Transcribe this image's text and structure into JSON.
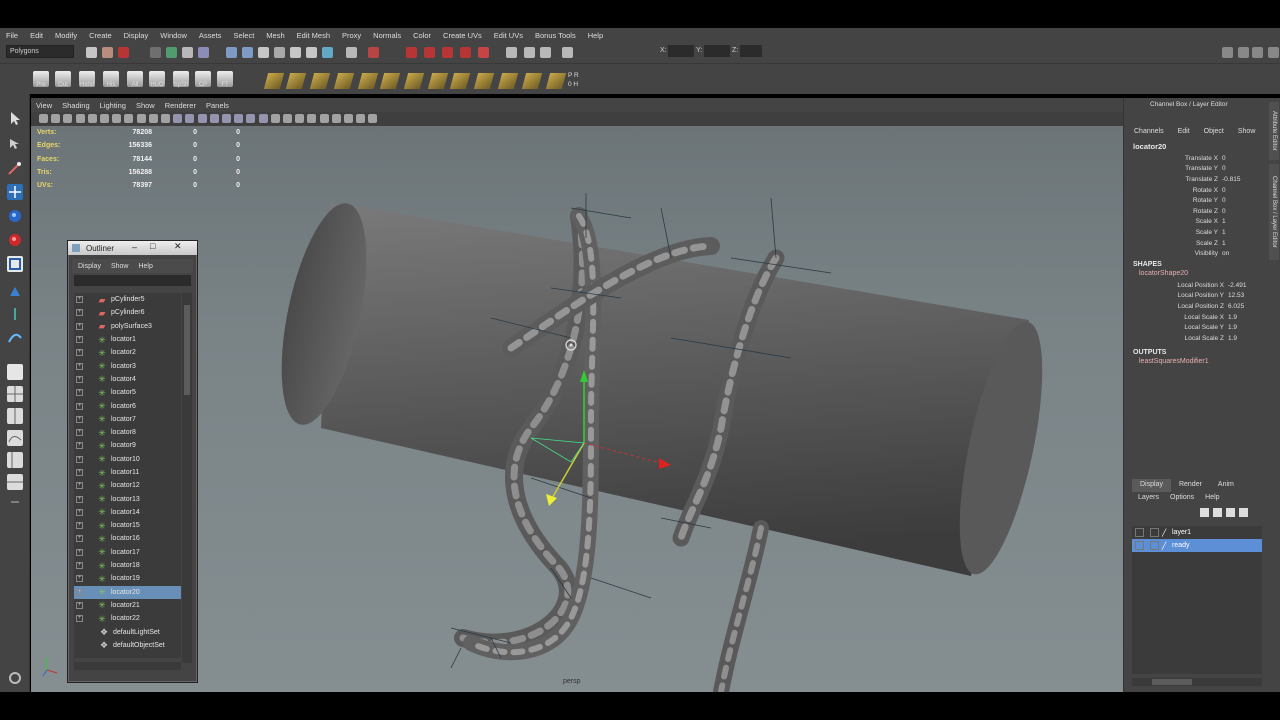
{
  "menubar": [
    "File",
    "Edit",
    "Modify",
    "Create",
    "Display",
    "Window",
    "Assets",
    "Select",
    "Mesh",
    "Edit Mesh",
    "Proxy",
    "Normals",
    "Color",
    "Create UVs",
    "Edit UVs",
    "Bonus Tools",
    "Help"
  ],
  "mode_select": "Polygons",
  "shelf_labels": [
    "Pre",
    "Out",
    "Hshd",
    "His",
    "All",
    "HUO",
    "SpSh",
    "CP",
    "FT"
  ],
  "coord_labels": [
    "X:",
    "Y:",
    "Z:"
  ],
  "pr_labels": [
    "P R",
    "0 H"
  ],
  "viewport": {
    "menu": [
      "View",
      "Shading",
      "Lighting",
      "Show",
      "Renderer",
      "Panels"
    ],
    "camera": "persp",
    "hud": [
      {
        "label": "Verts:",
        "v1": "78208",
        "v2": "0",
        "v3": "0"
      },
      {
        "label": "Edges:",
        "v1": "156336",
        "v2": "0",
        "v3": "0"
      },
      {
        "label": "Faces:",
        "v1": "78144",
        "v2": "0",
        "v3": "0"
      },
      {
        "label": "Tris:",
        "v1": "156288",
        "v2": "0",
        "v3": "0"
      },
      {
        "label": "UVs:",
        "v1": "78397",
        "v2": "0",
        "v3": "0"
      }
    ]
  },
  "outliner": {
    "title": "Outliner",
    "menu": [
      "Display",
      "Show",
      "Help"
    ],
    "items": [
      {
        "name": "pCylinder5",
        "icon": "mesh"
      },
      {
        "name": "pCylinder6",
        "icon": "mesh"
      },
      {
        "name": "polySurface3",
        "icon": "mesh"
      },
      {
        "name": "locator1",
        "icon": "locator"
      },
      {
        "name": "locator2",
        "icon": "locator"
      },
      {
        "name": "locator3",
        "icon": "locator"
      },
      {
        "name": "locator4",
        "icon": "locator"
      },
      {
        "name": "locator5",
        "icon": "locator"
      },
      {
        "name": "locator6",
        "icon": "locator"
      },
      {
        "name": "locator7",
        "icon": "locator"
      },
      {
        "name": "locator8",
        "icon": "locator"
      },
      {
        "name": "locator9",
        "icon": "locator"
      },
      {
        "name": "locator10",
        "icon": "locator"
      },
      {
        "name": "locator11",
        "icon": "locator"
      },
      {
        "name": "locator12",
        "icon": "locator"
      },
      {
        "name": "locator13",
        "icon": "locator"
      },
      {
        "name": "locator14",
        "icon": "locator"
      },
      {
        "name": "locator15",
        "icon": "locator"
      },
      {
        "name": "locator16",
        "icon": "locator"
      },
      {
        "name": "locator17",
        "icon": "locator"
      },
      {
        "name": "locator18",
        "icon": "locator"
      },
      {
        "name": "locator19",
        "icon": "locator"
      },
      {
        "name": "locator20",
        "icon": "locator",
        "selected": true
      },
      {
        "name": "locator21",
        "icon": "locator"
      },
      {
        "name": "locator22",
        "icon": "locator"
      },
      {
        "name": "defaultLightSet",
        "icon": "set"
      },
      {
        "name": "defaultObjectSet",
        "icon": "set"
      }
    ]
  },
  "channel_box": {
    "header": "Channel Box / Layer Editor",
    "menu": [
      "Channels",
      "Edit",
      "Object",
      "Show"
    ],
    "object": "locator20",
    "attributes": [
      {
        "name": "Translate X",
        "value": "0"
      },
      {
        "name": "Translate Y",
        "value": "0"
      },
      {
        "name": "Translate Z",
        "value": "-0.815"
      },
      {
        "name": "Rotate X",
        "value": "0"
      },
      {
        "name": "Rotate Y",
        "value": "0"
      },
      {
        "name": "Rotate Z",
        "value": "0"
      },
      {
        "name": "Scale X",
        "value": "1"
      },
      {
        "name": "Scale Y",
        "value": "1"
      },
      {
        "name": "Scale Z",
        "value": "1"
      },
      {
        "name": "Visibility",
        "value": "on"
      }
    ],
    "shapes_label": "SHAPES",
    "shape_name": "locatorShape20",
    "shape_attributes": [
      {
        "name": "Local Position X",
        "value": "-2.491"
      },
      {
        "name": "Local Position Y",
        "value": "12.53"
      },
      {
        "name": "Local Position Z",
        "value": "6.025"
      },
      {
        "name": "Local Scale X",
        "value": "1.9"
      },
      {
        "name": "Local Scale Y",
        "value": "1.9"
      },
      {
        "name": "Local Scale Z",
        "value": "1.9"
      }
    ],
    "outputs_label": "OUTPUTS",
    "output_name": "leastSquaresModifier1",
    "side_tabs": [
      "Attribute Editor",
      "Channel Box / Layer Editor"
    ]
  },
  "layer_editor": {
    "tabs": [
      "Display",
      "Render",
      "Anim"
    ],
    "menu": [
      "Layers",
      "Options",
      "Help"
    ],
    "layers": [
      {
        "name": "layer1",
        "selected": false
      },
      {
        "name": "ready",
        "selected": true
      }
    ]
  }
}
